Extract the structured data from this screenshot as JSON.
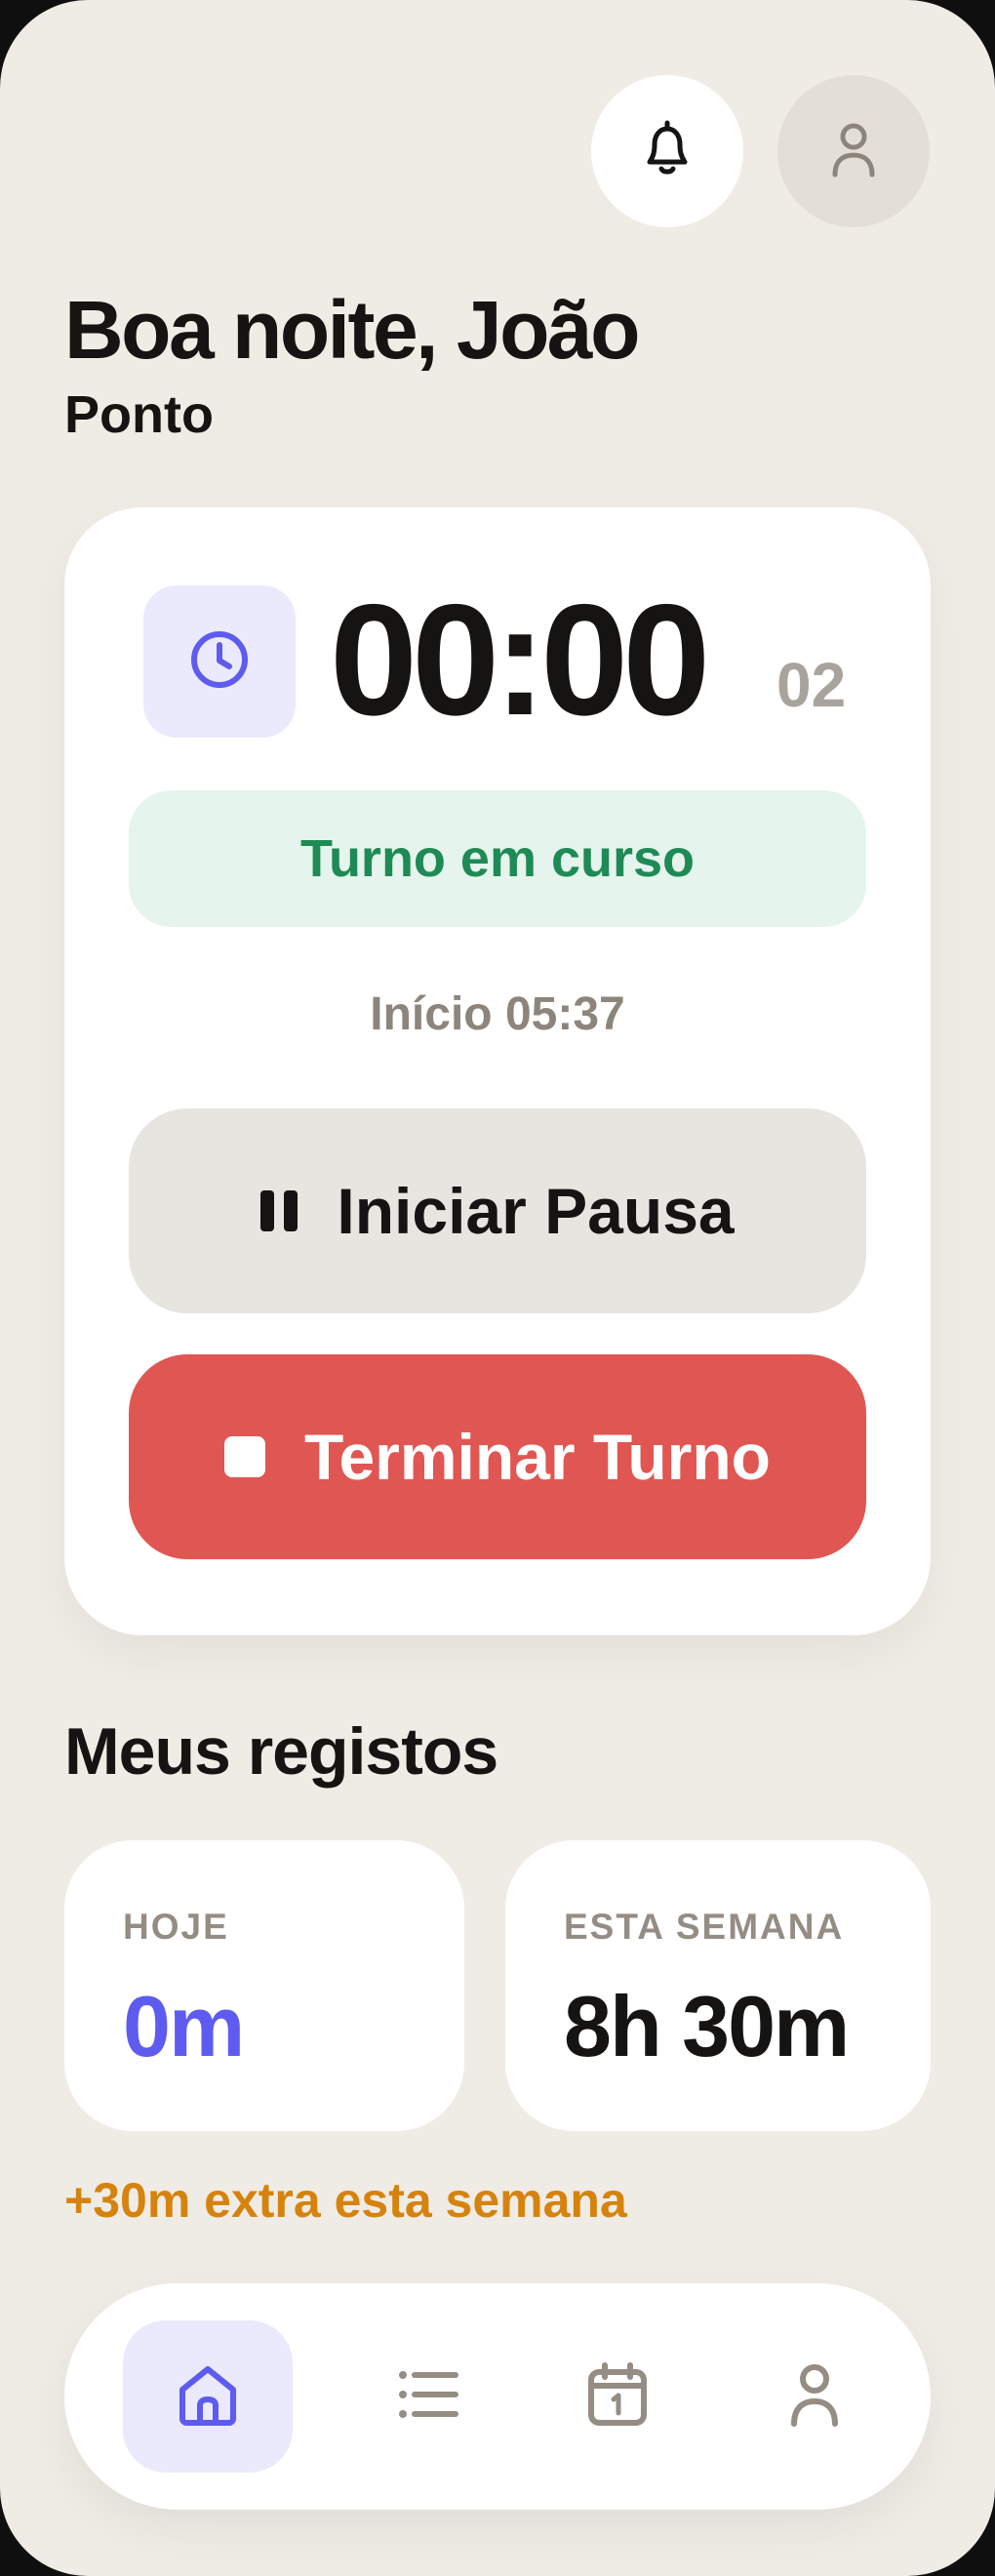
{
  "header": {
    "greeting": "Boa noite, João",
    "subtitle": "Ponto",
    "notifications_icon": "bell-icon",
    "profile_icon": "user-icon"
  },
  "shift": {
    "timer_main": "00:00",
    "timer_seconds": "02",
    "status": "Turno em curso",
    "start_time": "Início 05:37",
    "pause_label": "Iniciar Pausa",
    "end_label": "Terminar Turno"
  },
  "records": {
    "title": "Meus registos",
    "today": {
      "label": "HOJE",
      "value": "0m"
    },
    "week": {
      "label": "ESTA SEMANA",
      "value": "8h 30m"
    },
    "extra_note": "+30m extra esta semana"
  },
  "nav": {
    "items": [
      {
        "icon": "home-icon",
        "active": true
      },
      {
        "icon": "list-icon",
        "active": false
      },
      {
        "icon": "calendar-icon",
        "active": false
      },
      {
        "icon": "user-icon",
        "active": false
      }
    ]
  },
  "colors": {
    "background": "#efece6",
    "accent": "#5e5bf0",
    "success": "#1e8a55",
    "danger": "#e05652",
    "warning": "#d6830e"
  }
}
